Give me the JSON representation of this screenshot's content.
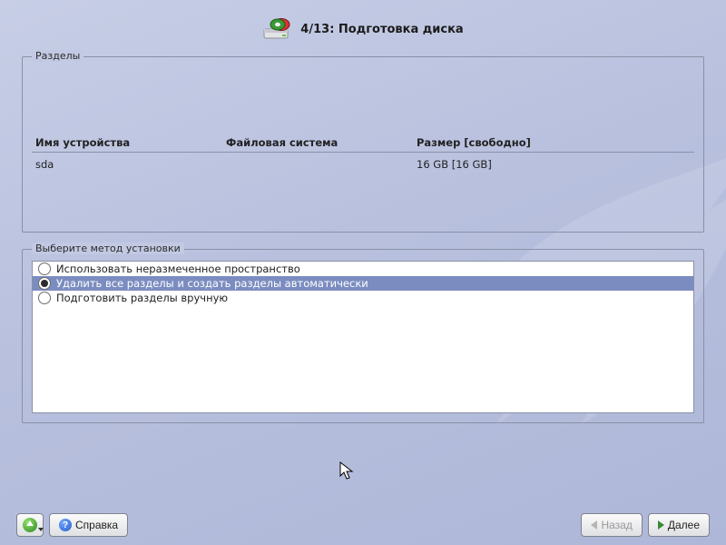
{
  "header": {
    "step": "4/13",
    "title": "Подготовка диска"
  },
  "partitions": {
    "legend": "Разделы",
    "cols": {
      "device": "Имя устройства",
      "fs": "Файловая система",
      "size": "Размер [свободно]"
    },
    "rows": [
      {
        "device": "sda",
        "fs": "",
        "size": "16 GB [16 GB]"
      }
    ]
  },
  "method": {
    "legend": "Выберите метод установки",
    "options": [
      {
        "label": "Использовать неразмеченное пространство",
        "selected": false
      },
      {
        "label": "Удалить все разделы и создать разделы автоматически",
        "selected": true
      },
      {
        "label": "Подготовить разделы вручную",
        "selected": false
      }
    ]
  },
  "footer": {
    "help": "Справка",
    "back": "Назад",
    "next": "Далее"
  }
}
